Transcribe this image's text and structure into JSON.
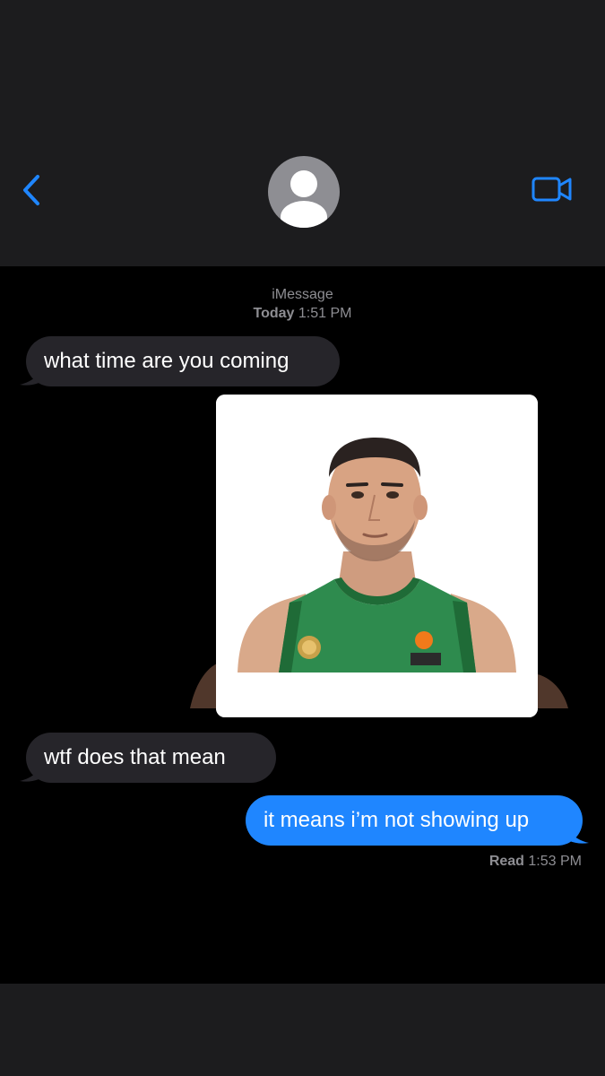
{
  "header": {
    "back_icon": "chevron-left-icon",
    "avatar_icon": "contact-silhouette-icon",
    "video_icon": "video-camera-icon",
    "accent_color": "#1f86ff"
  },
  "conversation": {
    "service": "iMessage",
    "day": "Today",
    "time": "1:51 PM",
    "messages": [
      {
        "direction": "incoming",
        "text": "what time are you coming"
      },
      {
        "direction": "outgoing",
        "type": "image",
        "description": "photo"
      },
      {
        "direction": "incoming",
        "text": "wtf does that mean"
      },
      {
        "direction": "outgoing",
        "text": "it means i’m not showing up"
      }
    ],
    "read_label": "Read",
    "read_time": "1:53 PM"
  },
  "colors": {
    "incoming_bubble": "#26252a",
    "outgoing_bubble": "#1f86ff",
    "background": "#000000",
    "bar": "#1c1c1e"
  }
}
